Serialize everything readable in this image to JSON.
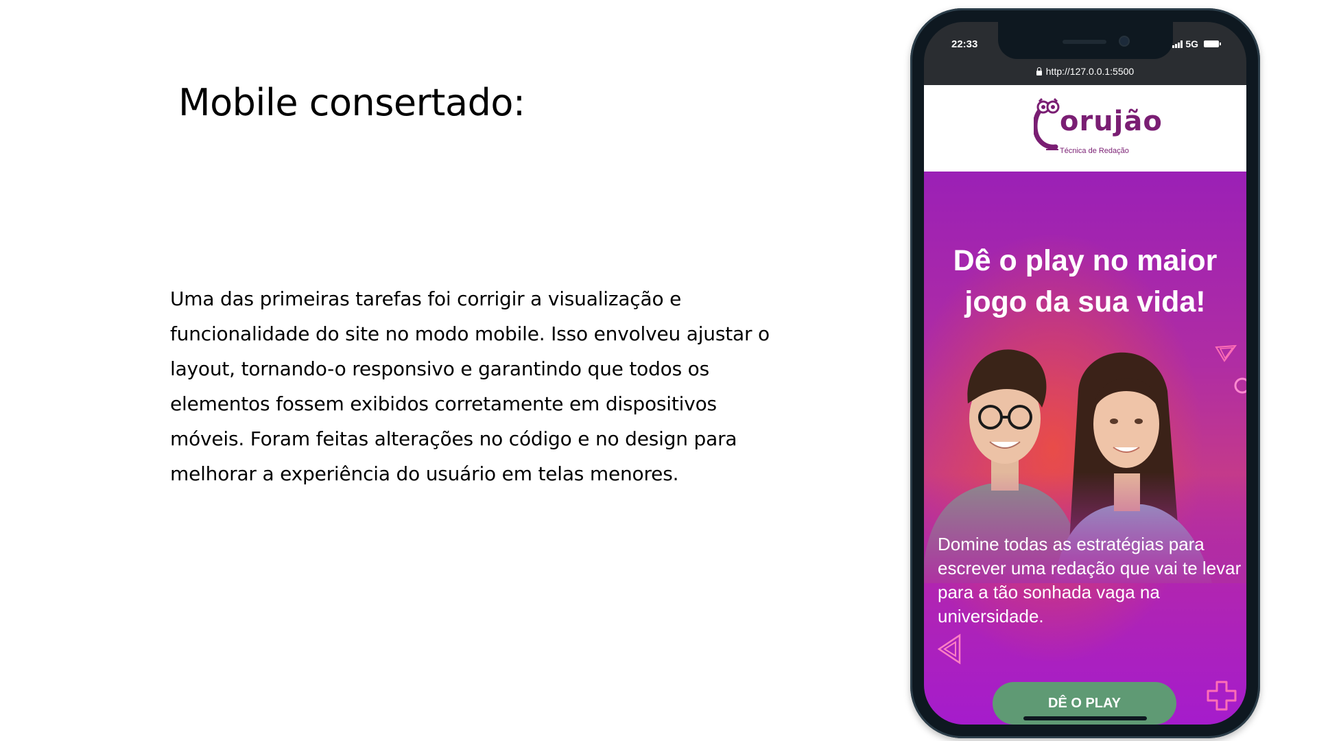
{
  "slide": {
    "title": "Mobile consertado:",
    "body": "Uma das primeiras tarefas foi corrigir a visualização e funcionalidade do site no modo mobile. Isso envolveu ajustar o layout, tornando-o responsivo e garantindo que todos os elementos fossem exibidos corretamente em dispositivos móveis. Foram feitas alterações no código e no design para melhorar a experiência do usuário em telas menores."
  },
  "phone": {
    "status_time": "22:33",
    "network": "5G",
    "url": "http://127.0.0.1:5500"
  },
  "site": {
    "logo_text": "orujão",
    "logo_subtitle": "Técnica de Redação",
    "hero_title": "Dê o play no maior jogo da sua vida!",
    "hero_description": "Domine todas as estratégias para escrever uma redação que vai te levar para a tão sonhada vaga na universidade.",
    "cta_label": "DÊ O PLAY",
    "colors": {
      "brand": "#7a1e73",
      "hero_purple": "#a51ccc",
      "cta_green": "#5f9a74"
    }
  }
}
